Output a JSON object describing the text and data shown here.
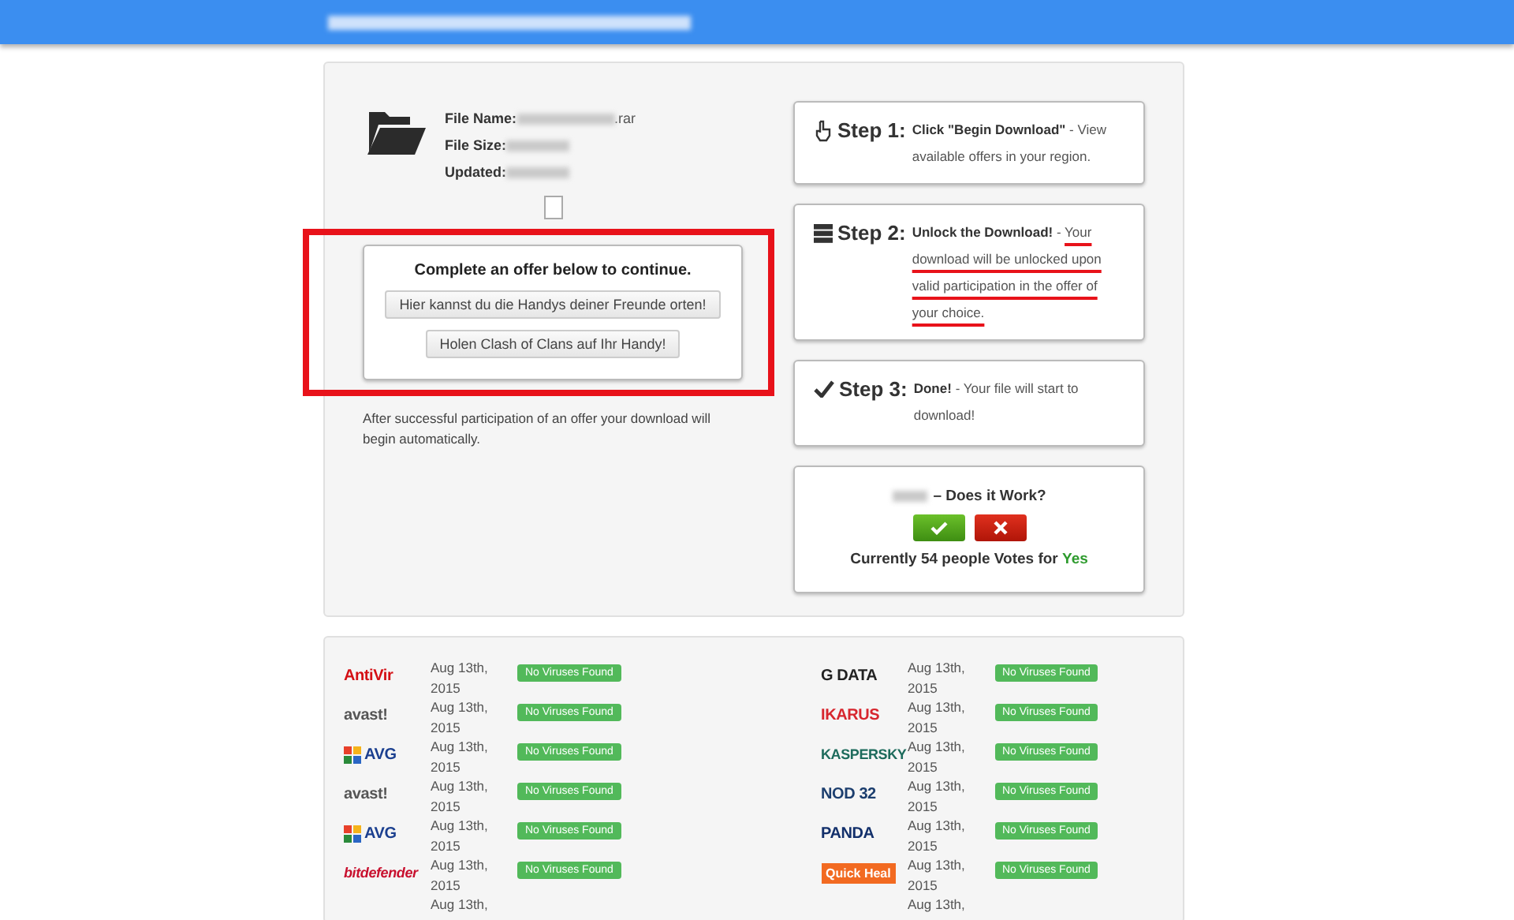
{
  "file_info": [
    {
      "label": "File Name:",
      "value": ".rar"
    },
    {
      "label": "File Size:"
    },
    {
      "label": "Updated:"
    }
  ],
  "offer": {
    "heading": "Complete an offer below to continue.",
    "highlighted": true,
    "buttons": [
      "Hier kannst du die Handys deiner Freunde orten!",
      "Holen Clash of Clans auf Ihr Handy!"
    ]
  },
  "offer_note": "After successful participation of an offer your download will begin automatically.",
  "steps": [
    {
      "step": "Step 1:",
      "title": "Click \"Begin Download\"",
      "dash": "-",
      "description": "View available offers in your region.",
      "highlighted": false
    },
    {
      "step": "Step 2:",
      "title": "Unlock the Download!",
      "dash": "-",
      "description": "Your download will be unlocked upon valid participation in the offer of your choice.",
      "highlighted": true
    },
    {
      "step": "Step 3:",
      "title": "Done!",
      "dash": "-",
      "description": "Your file will start to download!",
      "highlighted": false
    }
  ],
  "vote": {
    "question": "– Does it Work?",
    "text": "Currently 54 people Votes for",
    "answer": "Yes"
  },
  "scans": [
    [
      {
        "logo": "AntiVir",
        "kind": "wordmark",
        "color": "#d40f14",
        "date": "Aug 13th,",
        "year": "2015",
        "result": "No Viruses Found"
      },
      {
        "logo": "avast!",
        "kind": "wordmark",
        "color": "#555555",
        "date": "Aug 13th,",
        "year": "2015",
        "result": "No Viruses Found"
      },
      {
        "logo": "AVG",
        "kind": "tiles",
        "color": "#1b3f8f",
        "date": "Aug 13th,",
        "year": "2015",
        "result": "No Viruses Found"
      },
      {
        "logo": "avast!",
        "kind": "wordmark",
        "color": "#555555",
        "date": "Aug 13th,",
        "year": "2015",
        "result": "No Viruses Found"
      },
      {
        "logo": "AVG",
        "kind": "tiles",
        "color": "#1b3f8f",
        "date": "Aug 13th,",
        "year": "2015",
        "result": "No Viruses Found"
      },
      {
        "logo": "bitdefender",
        "kind": "wordmark",
        "color": "#c8102e",
        "date": "Aug 13th,",
        "year": "2015",
        "result": "No Viruses Found"
      },
      {
        "kind": "cut",
        "date": "Aug 13th,"
      }
    ],
    [
      {
        "logo": "G DATA",
        "kind": "wordmark",
        "color": "#222222",
        "date": "Aug 13th,",
        "year": "2015",
        "result": "No Viruses Found"
      },
      {
        "logo": "IKARUS",
        "kind": "wordmark",
        "color": "#d7262e",
        "date": "Aug 13th,",
        "year": "2015",
        "result": "No Viruses Found"
      },
      {
        "logo": "KASPERSKY",
        "kind": "wordmark",
        "color": "#1d6b5c",
        "date": "Aug 13th,",
        "year": "2015",
        "result": "No Viruses Found"
      },
      {
        "logo": "NOD 32",
        "kind": "wordmark",
        "color": "#1c3e6e",
        "date": "Aug 13th,",
        "year": "2015",
        "result": "No Viruses Found"
      },
      {
        "logo": "PANDA",
        "kind": "wordmark",
        "color": "#13306b",
        "date": "Aug 13th,",
        "year": "2015",
        "result": "No Viruses Found"
      },
      {
        "logo": "Quick Heal",
        "kind": "boxed",
        "color": "#f26a21",
        "date": "Aug 13th,",
        "year": "2015",
        "result": "No Viruses Found"
      },
      {
        "kind": "cut",
        "date": "Aug 13th,"
      }
    ]
  ]
}
